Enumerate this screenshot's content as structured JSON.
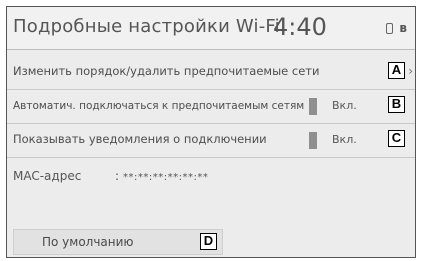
{
  "header": {
    "title": "Подробные настройки Wi-Fi",
    "clock": "4:40",
    "icons": [
      "phone-icon",
      "bluetooth-icon"
    ]
  },
  "rows": [
    {
      "label": "Изменить порядок/удалить предпочитаемые сети",
      "callout": "A"
    },
    {
      "label": "Автоматич. подключаться к предпочитаемым сетям",
      "state": "Вкл.",
      "callout": "B"
    },
    {
      "label": "Показывать уведомления о подключении",
      "state": "Вкл.",
      "callout": "C"
    }
  ],
  "mac": {
    "label": "MAC-адрес",
    "separator": ":",
    "value": "**:**:**:**:**:**"
  },
  "default_button": {
    "label": "По умолчанию",
    "callout": "D"
  },
  "colors": {
    "screen_bg": "#ececec",
    "toggle_indicator": "#8f8f8f",
    "text": "#4d4d4d"
  }
}
